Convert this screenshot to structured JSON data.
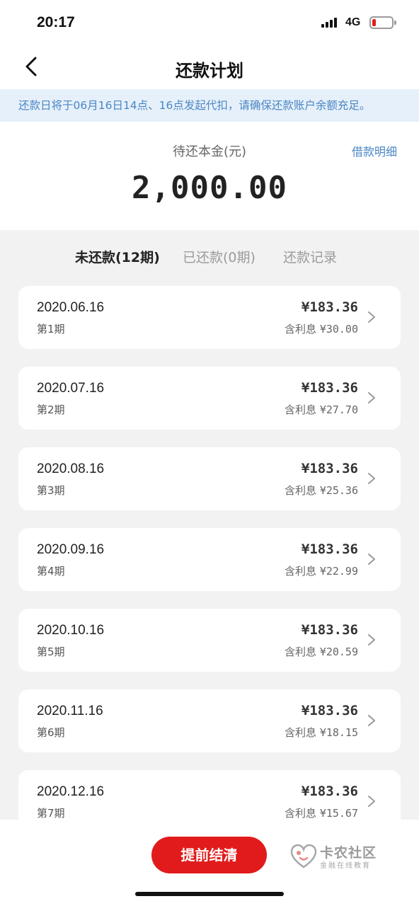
{
  "status_bar": {
    "time": "20:17",
    "network": "4G"
  },
  "nav": {
    "title": "还款计划",
    "back_icon": "chevron-left-icon"
  },
  "notice": {
    "text": "还款日将于06月16日14点、16点发起代扣，请确保还款账户余额充足。"
  },
  "summary": {
    "principal_label": "待还本金(元)",
    "principal_amount": "2,000.00",
    "loan_detail_link": "借款明细"
  },
  "tabs": [
    {
      "label": "未还款(12期)",
      "active": true
    },
    {
      "label": "已还款(0期)",
      "active": false
    },
    {
      "label": "还款记录",
      "active": false
    }
  ],
  "interest_label": "含利息",
  "installments": [
    {
      "date": "2020.06.16",
      "period": "第1期",
      "amount": "¥183.36",
      "interest": "¥30.00"
    },
    {
      "date": "2020.07.16",
      "period": "第2期",
      "amount": "¥183.36",
      "interest": "¥27.70"
    },
    {
      "date": "2020.08.16",
      "period": "第3期",
      "amount": "¥183.36",
      "interest": "¥25.36"
    },
    {
      "date": "2020.09.16",
      "period": "第4期",
      "amount": "¥183.36",
      "interest": "¥22.99"
    },
    {
      "date": "2020.10.16",
      "period": "第5期",
      "amount": "¥183.36",
      "interest": "¥20.59"
    },
    {
      "date": "2020.11.16",
      "period": "第6期",
      "amount": "¥183.36",
      "interest": "¥18.15"
    },
    {
      "date": "2020.12.16",
      "period": "第7期",
      "amount": "¥183.36",
      "interest": "¥15.67"
    }
  ],
  "bottom": {
    "settle_button": "提前结清",
    "watermark_name": "卡农社区",
    "watermark_sub": "金融在线教育"
  },
  "colors": {
    "accent_red": "#e11b1b",
    "link_blue": "#4a86c4",
    "notice_bg": "#e6f0fa",
    "page_bg": "#f2f2f2",
    "battery_low": "#e02020"
  }
}
